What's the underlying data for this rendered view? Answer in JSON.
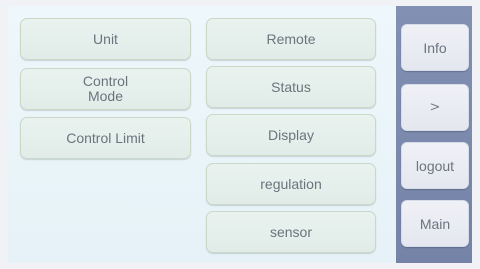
{
  "left_column": {
    "unit": "Unit",
    "control_mode": "Control\nMode",
    "control_limit": "Control Limit"
  },
  "middle_column": {
    "remote": "Remote",
    "status": "Status",
    "display": "Display",
    "regulation": "regulation",
    "sensor": "sensor"
  },
  "sidebar": {
    "info": "Info",
    "next": ">",
    "logout": "logout",
    "main": "Main"
  }
}
